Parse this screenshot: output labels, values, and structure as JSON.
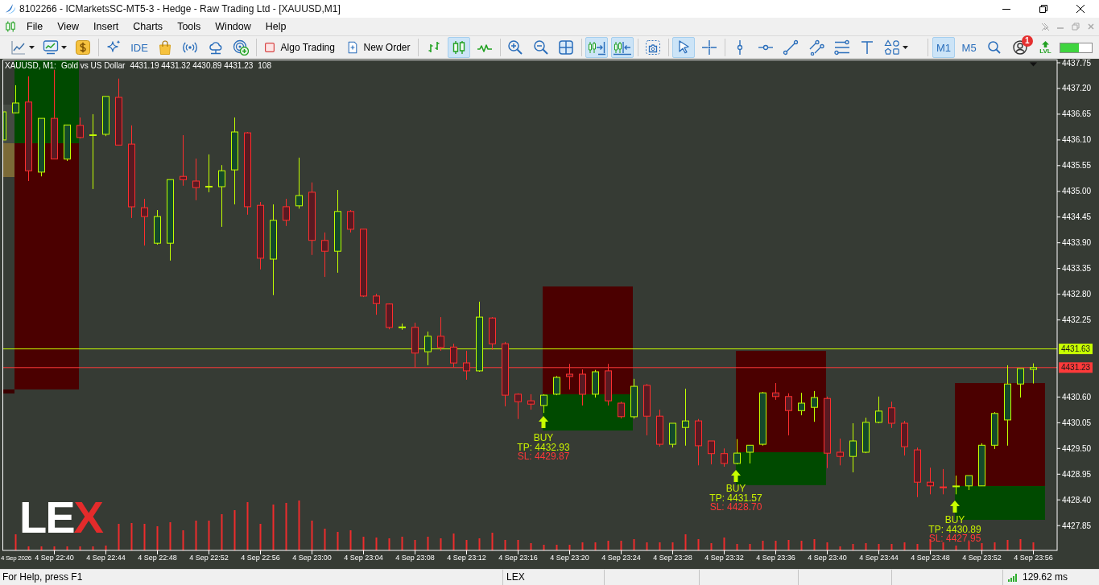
{
  "window": {
    "title": "8102266 - ICMarketsSC-MT5-3 - Hedge - Raw Trading Ltd - [XAUUSD,M1]"
  },
  "menu": [
    "File",
    "View",
    "Insert",
    "Charts",
    "Tools",
    "Window",
    "Help"
  ],
  "toolbar": {
    "ide": "IDE",
    "algo_trading": {
      "label": "Algo Trading",
      "on": false
    },
    "new_order": "New Order",
    "chart_types": [
      {
        "selected": false
      },
      {
        "selected": true
      },
      {
        "selected": false
      }
    ],
    "auto_scroll": {
      "selected": true
    },
    "chart_shift": {
      "selected": true
    },
    "pointers": [
      {
        "selected": true
      },
      {
        "selected": false
      }
    ],
    "timeframes": [
      {
        "label": "M1",
        "selected": true
      },
      {
        "label": "M5",
        "selected": false
      }
    ],
    "notifications": "1",
    "lvl": "LVL",
    "meter": {
      "level": 0.6
    }
  },
  "chart": {
    "info": {
      "symbol": "XAUUSD, M1:",
      "description": "Gold vs US Dollar",
      "prices": "4431.19 4431.32 4430.89 4431.23",
      "volume": "108"
    },
    "date_label": "4 Sep 2026",
    "chart_data": {
      "type": "candlestick",
      "categories": [
        null,
        null,
        null,
        null,
        "4 Sep 22:40",
        null,
        null,
        null,
        "4 Sep 22:44",
        null,
        null,
        null,
        "4 Sep 22:48",
        null,
        null,
        null,
        "4 Sep 22:52",
        null,
        null,
        null,
        "4 Sep 22:56",
        null,
        null,
        null,
        "4 Sep 23:00",
        null,
        null,
        null,
        "4 Sep 23:04",
        null,
        null,
        null,
        "4 Sep 23:08",
        null,
        null,
        null,
        "4 Sep 23:12",
        null,
        null,
        null,
        "4 Sep 23:16",
        null,
        null,
        null,
        "4 Sep 23:20",
        null,
        null,
        null,
        "4 Sep 23:24",
        null,
        null,
        null,
        "4 Sep 23:28",
        null,
        null,
        null,
        "4 Sep 23:32",
        null,
        null,
        null,
        "4 Sep 23:36",
        null,
        null,
        null,
        "4 Sep 23:40",
        null,
        null,
        null,
        "4 Sep 23:44",
        null,
        null,
        null,
        "4 Sep 23:48",
        null,
        null,
        null,
        "4 Sep 23:52",
        null,
        null,
        null,
        "4 Sep 23:56"
      ],
      "ohlc": [
        [
          4436.1,
          4436.7,
          4436.1,
          4436.7
        ],
        [
          4436.68,
          4437.27,
          4436.67,
          4436.89
        ],
        [
          4436.91,
          4437.46,
          4435.22,
          4435.44
        ],
        [
          4435.41,
          4436.56,
          4435.32,
          4436.56
        ],
        [
          4436.56,
          4437.6,
          4435.69,
          4435.69
        ],
        [
          4435.69,
          4436.42,
          4435.65,
          4436.42
        ],
        [
          4436.41,
          4436.58,
          4436.13,
          4436.15
        ],
        [
          4436.2,
          4436.65,
          4435.05,
          4436.2
        ],
        [
          4436.22,
          4437.03,
          4436.18,
          4437.03
        ],
        [
          4437.01,
          4437.41,
          4435.99,
          4435.99
        ],
        [
          4436.01,
          4436.41,
          4434.43,
          4434.67
        ],
        [
          4434.65,
          4434.84,
          4433.84,
          4434.46
        ],
        [
          4433.89,
          4434.6,
          4433.86,
          4434.46
        ],
        [
          4433.89,
          4435.25,
          4433.52,
          4435.25
        ],
        [
          4435.32,
          4436.2,
          4435.12,
          4435.25
        ],
        [
          4435.22,
          4435.7,
          4434.81,
          4435.08
        ],
        [
          4435.1,
          4435.79,
          4434.98,
          4435.1
        ],
        [
          4435.1,
          4435.56,
          4434.24,
          4435.44
        ],
        [
          4435.46,
          4436.58,
          4434.72,
          4436.27
        ],
        [
          4436.25,
          4436.27,
          4434.5,
          4434.67
        ],
        [
          4434.7,
          4434.77,
          4433.33,
          4433.57
        ],
        [
          4433.55,
          4434.72,
          4432.78,
          4434.38
        ],
        [
          4434.67,
          4434.84,
          4434.26,
          4434.38
        ],
        [
          4434.69,
          4435.72,
          4434.63,
          4434.91
        ],
        [
          4434.98,
          4435.19,
          4433.64,
          4433.95
        ],
        [
          4433.95,
          4434.12,
          4433.17,
          4433.72
        ],
        [
          4433.72,
          4435.03,
          4433.26,
          4434.57
        ],
        [
          4434.57,
          4434.6,
          4434.12,
          4434.19
        ],
        [
          4434.19,
          4434.19,
          4432.74,
          4432.76
        ],
        [
          4432.76,
          4432.81,
          4432.36,
          4432.6
        ],
        [
          4432.59,
          4432.6,
          4432.05,
          4432.09
        ],
        [
          4432.09,
          4432.17,
          4432.04,
          4432.09
        ],
        [
          4432.09,
          4432.19,
          4431.23,
          4431.54
        ],
        [
          4431.57,
          4432.0,
          4431.28,
          4431.9
        ],
        [
          4431.9,
          4432.31,
          4431.59,
          4431.66
        ],
        [
          4431.67,
          4431.74,
          4431.23,
          4431.33
        ],
        [
          4431.33,
          4431.59,
          4430.97,
          4431.16
        ],
        [
          4431.16,
          4432.64,
          4431.14,
          4432.31
        ],
        [
          4432.29,
          4432.31,
          4431.61,
          4431.74
        ],
        [
          4431.74,
          4431.78,
          4430.4,
          4430.64
        ],
        [
          4430.66,
          4430.68,
          4430.13,
          4430.5
        ],
        [
          4430.52,
          4430.66,
          4430.33,
          4430.45
        ],
        [
          4430.42,
          4430.66,
          4430.26,
          4430.64
        ],
        [
          4430.66,
          4431.05,
          4430.64,
          4431.02
        ],
        [
          4431.09,
          4431.31,
          4430.76,
          4431.04
        ],
        [
          4431.09,
          4431.19,
          4430.42,
          4430.66
        ],
        [
          4430.66,
          4431.18,
          4430.59,
          4431.14
        ],
        [
          4431.16,
          4431.31,
          4430.42,
          4430.52
        ],
        [
          4430.47,
          4430.5,
          4430.14,
          4430.18
        ],
        [
          4430.18,
          4430.99,
          4430.14,
          4430.83
        ],
        [
          4430.85,
          4430.88,
          4429.78,
          4430.19
        ],
        [
          4430.19,
          4430.33,
          4429.54,
          4429.59
        ],
        [
          4429.59,
          4430.04,
          4429.52,
          4430.04
        ],
        [
          4429.95,
          4430.78,
          4429.56,
          4430.09
        ],
        [
          4430.09,
          4430.13,
          4429.14,
          4429.56
        ],
        [
          4429.66,
          4429.66,
          4429.16,
          4429.39
        ],
        [
          4429.39,
          4429.5,
          4429.11,
          4429.18
        ],
        [
          4429.18,
          4429.7,
          4429.16,
          4429.4
        ],
        [
          4429.42,
          4429.57,
          4429.18,
          4429.57
        ],
        [
          4429.59,
          4430.71,
          4429.56,
          4430.69
        ],
        [
          4430.69,
          4430.9,
          4430.54,
          4430.61
        ],
        [
          4430.61,
          4430.68,
          4429.78,
          4430.31
        ],
        [
          4430.31,
          4430.69,
          4430.21,
          4430.47
        ],
        [
          4430.38,
          4430.73,
          4430.07,
          4430.59
        ],
        [
          4430.57,
          4430.61,
          4429.08,
          4429.4
        ],
        [
          4429.42,
          4429.71,
          4429.14,
          4429.33
        ],
        [
          4429.33,
          4430.04,
          4428.99,
          4429.66
        ],
        [
          4429.42,
          4430.16,
          4429.4,
          4430.06
        ],
        [
          4430.06,
          4430.61,
          4430.04,
          4430.3
        ],
        [
          4430.37,
          4430.5,
          4429.94,
          4430.04
        ],
        [
          4430.04,
          4430.09,
          4429.35,
          4429.54
        ],
        [
          4429.47,
          4429.52,
          4428.46,
          4428.78
        ],
        [
          4428.78,
          4429.09,
          4428.52,
          4428.7
        ],
        [
          4428.67,
          4429.06,
          4428.52,
          4428.66
        ],
        [
          4428.68,
          4428.92,
          4428.52,
          4428.69
        ],
        [
          4428.7,
          4428.92,
          4428.61,
          4428.92
        ],
        [
          4428.7,
          4429.61,
          4428.7,
          4429.57
        ],
        [
          4429.57,
          4430.28,
          4429.49,
          4430.25
        ],
        [
          4430.11,
          4431.28,
          4429.56,
          4430.88
        ],
        [
          4430.88,
          4431.21,
          4430.59,
          4431.21
        ],
        [
          4431.19,
          4431.32,
          4430.89,
          4431.23
        ]
      ],
      "ylim": [
        4427.32,
        4437.81
      ],
      "yticks": [
        {
          "value": 4437.75,
          "label": "4437.75"
        },
        {
          "value": 4437.2,
          "label": "4437.20"
        },
        {
          "value": 4436.65,
          "label": "4436.65"
        },
        {
          "value": 4436.1,
          "label": "4436.10"
        },
        {
          "value": 4435.55,
          "label": "4435.55"
        },
        {
          "value": 4435.0,
          "label": "4435.00"
        },
        {
          "value": 4434.45,
          "label": "4434.45"
        },
        {
          "value": 4433.9,
          "label": "4433.90"
        },
        {
          "value": 4433.35,
          "label": "4433.35"
        },
        {
          "value": 4432.8,
          "label": "4432.80"
        },
        {
          "value": 4432.25,
          "label": "4432.25"
        },
        {
          "value": 4430.6,
          "label": "4430.60"
        },
        {
          "value": 4430.05,
          "label": "4430.05"
        },
        {
          "value": 4429.5,
          "label": "4429.50"
        },
        {
          "value": 4428.95,
          "label": "4428.95"
        },
        {
          "value": 4428.4,
          "label": "4428.40"
        },
        {
          "value": 4427.85,
          "label": "4427.85"
        }
      ],
      "ref_lines": [
        {
          "axis": "y",
          "value": 4431.63,
          "label": "4431.63",
          "color": "#c8ff00"
        },
        {
          "axis": "y",
          "value": 4431.23,
          "label": "4431.23",
          "color": "#ff3a3a"
        }
      ]
    },
    "trades": [
      {
        "kind": "buy",
        "label": "BUY",
        "tp": "TP: 4432.93",
        "sl": "SL: 4429.87"
      },
      {
        "kind": "buy",
        "label": "BUY",
        "tp": "TP: 4431.57",
        "sl": "SL: 4428.70"
      },
      {
        "kind": "buy",
        "label": "BUY",
        "tp": "TP: 4430.89",
        "sl": "SL: 4427.95"
      }
    ],
    "logo": {
      "text": "LE",
      "accent": "X"
    }
  },
  "status_bar": {
    "help": "For Help, press F1",
    "profile": "LEX",
    "ping": "129.62 ms"
  }
}
